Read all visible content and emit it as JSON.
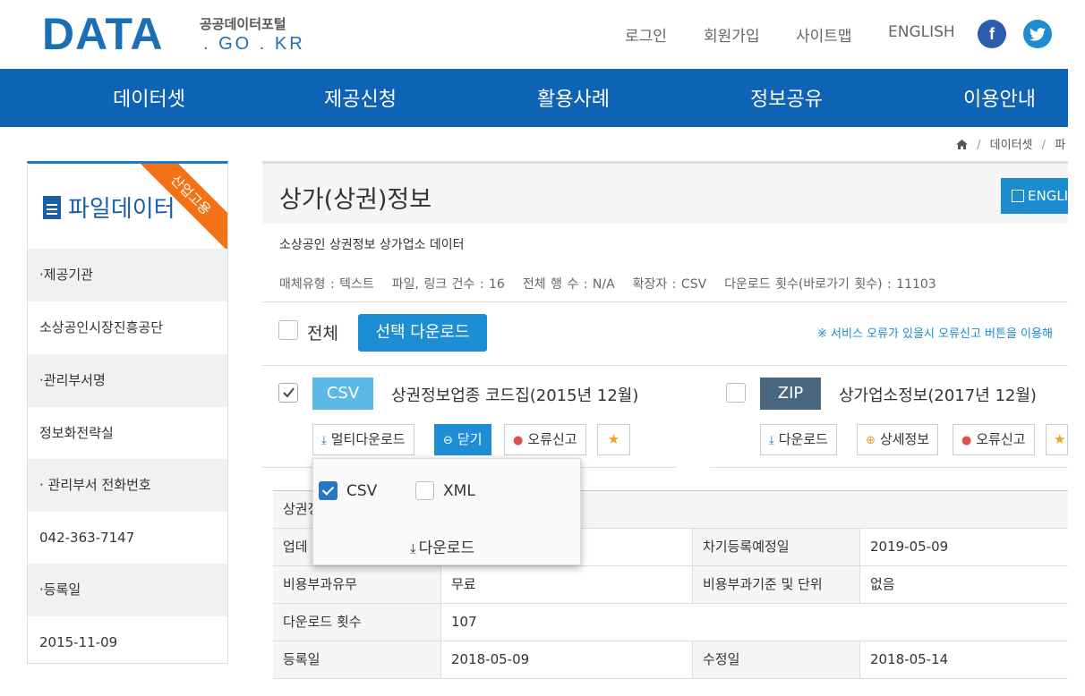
{
  "logo": {
    "main": "DATA",
    "korean": "공공데이터포털",
    "domain": ". GO . KR"
  },
  "top_links": [
    "로그인",
    "회원가입",
    "사이트맵",
    "ENGLISH"
  ],
  "social": {
    "facebook": "f",
    "twitter": "t"
  },
  "nav": [
    "데이터셋",
    "제공신청",
    "활용사례",
    "정보공유",
    "이용안내"
  ],
  "breadcrumb": {
    "item1": "데이터셋",
    "item2": "파"
  },
  "sidebar": {
    "title": "파일데이터",
    "ribbon": "산업고용",
    "rows": [
      "·제공기관",
      "소상공인시장진흥공단",
      "·관리부서명",
      "정보화전략실",
      "· 관리부서 전화번호",
      "042-363-7147",
      "·등록일",
      "2015-11-09"
    ]
  },
  "main": {
    "title": "상가(상권)정보",
    "english_button": "ENGLISH",
    "description": "소상공인 상권정보 상가업소 데이터",
    "meta": {
      "media": "매체유형 : 텍스트",
      "files": "파일, 링크 건수 : 16",
      "rows": "전체 행 수 : N/A",
      "ext": "확장자 : CSV",
      "downloads": "다운로드 횟수(바로가기 횟수) : 11103"
    },
    "select_all": "전체",
    "select_download": "선택 다운로드",
    "notice": "※ 서비스 오류가 있을시 오류신고 버튼을 이용해"
  },
  "files": [
    {
      "badge": "CSV",
      "name": "상권정보업종 코드집(2015년 12월)",
      "buttons": [
        "멀티다운로드",
        "닫기",
        "오류신고"
      ]
    },
    {
      "badge": "ZIP",
      "name": "상가업소정보(2017년 12월)",
      "buttons": [
        "다운로드",
        "상세정보",
        "오류신고"
      ]
    }
  ],
  "popup": {
    "opt1": "CSV",
    "opt2": "XML",
    "download": "다운로드"
  },
  "table": {
    "header_row": "상권정",
    "r1": {
      "k1": "업데",
      "v1": "",
      "k2": "차기등록예정일",
      "v2": "2019-05-09"
    },
    "r2": {
      "k1": "비용부과유무",
      "v1": "무료",
      "k2": "비용부과기준 및 단위",
      "v2": "없음"
    },
    "r3": {
      "k1": "다운로드 횟수",
      "v1": "107"
    },
    "r4": {
      "k1": "등록일",
      "v1": "2018-05-09",
      "k2": "수정일",
      "v2": "2018-05-14"
    }
  },
  "colors": {
    "brand_blue": "#0f63b5",
    "accent_blue": "#1d8ed3",
    "ribbon_orange": "#f47216"
  }
}
